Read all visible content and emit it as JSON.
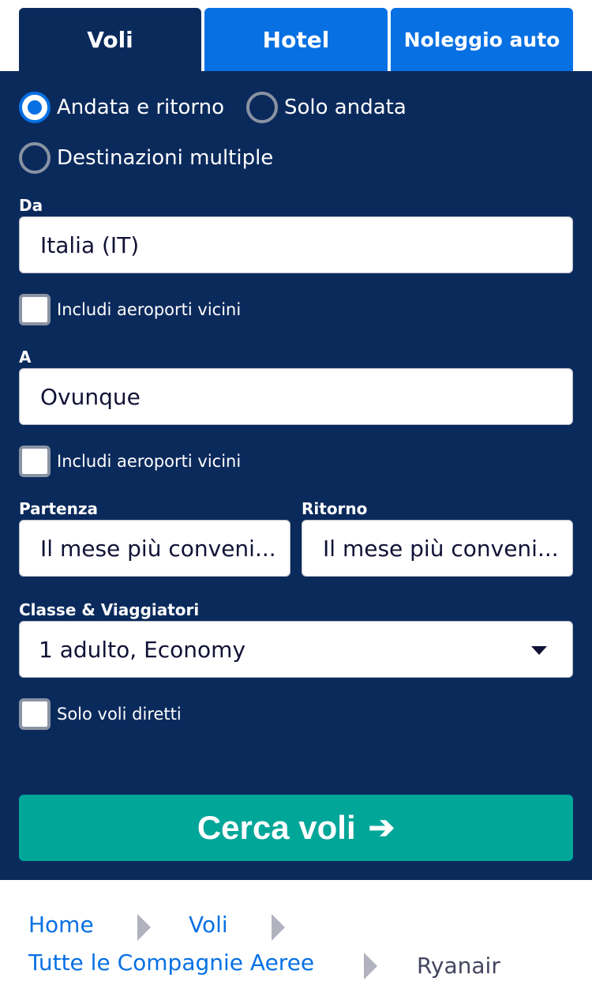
{
  "tabs": [
    {
      "label": "Voli",
      "active": true
    },
    {
      "label": "Hotel",
      "active": false
    },
    {
      "label": "Noleggio auto",
      "active": false
    }
  ],
  "trip_type": {
    "options": [
      "Andata e ritorno",
      "Solo andata",
      "Destinazioni multiple"
    ],
    "selected": "Andata e ritorno"
  },
  "from": {
    "label": "Da",
    "value": "Italia (IT)",
    "nearby_label": "Includi aeroporti vicini",
    "nearby_checked": false
  },
  "to": {
    "label": "A",
    "value": "Ovunque",
    "nearby_label": "Includi aeroporti vicini",
    "nearby_checked": false
  },
  "depart": {
    "label": "Partenza",
    "value": "Il mese più conveni..."
  },
  "return": {
    "label": "Ritorno",
    "value": "Il mese più conveni..."
  },
  "cabin": {
    "label": "Classe & Viaggiatori",
    "value": "1 adulto, Economy"
  },
  "direct": {
    "label": "Solo voli diretti",
    "checked": false
  },
  "search_button": {
    "label": "Cerca voli",
    "icon": "arrow-right-icon"
  },
  "breadcrumb": [
    "Home",
    "Voli",
    "Tutte le Compagnie Aeree",
    "Ryanair"
  ],
  "colors": {
    "panel": "#0b2a5c",
    "tab_inactive": "#0770e3",
    "search_button": "#00a698",
    "link": "#0770e3"
  }
}
